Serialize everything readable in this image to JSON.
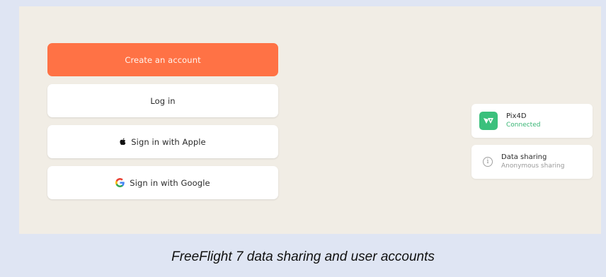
{
  "auth": {
    "create_account_label": "Create an account",
    "login_label": "Log in",
    "apple_label": "Sign in with Apple",
    "google_label": "Sign in with Google"
  },
  "services": {
    "pix4d": {
      "name": "Pix4D",
      "status": "Connected",
      "icon": "pix4d-logo-icon"
    },
    "data_sharing": {
      "title": "Data sharing",
      "subtitle": "Anonymous sharing",
      "icon": "info-icon"
    }
  },
  "caption": "FreeFlight 7 data sharing and user accounts",
  "colors": {
    "accent": "#ff7245",
    "connected": "#37b574",
    "panel_background": "#f1ede5",
    "page_background": "#dfe5f3"
  }
}
